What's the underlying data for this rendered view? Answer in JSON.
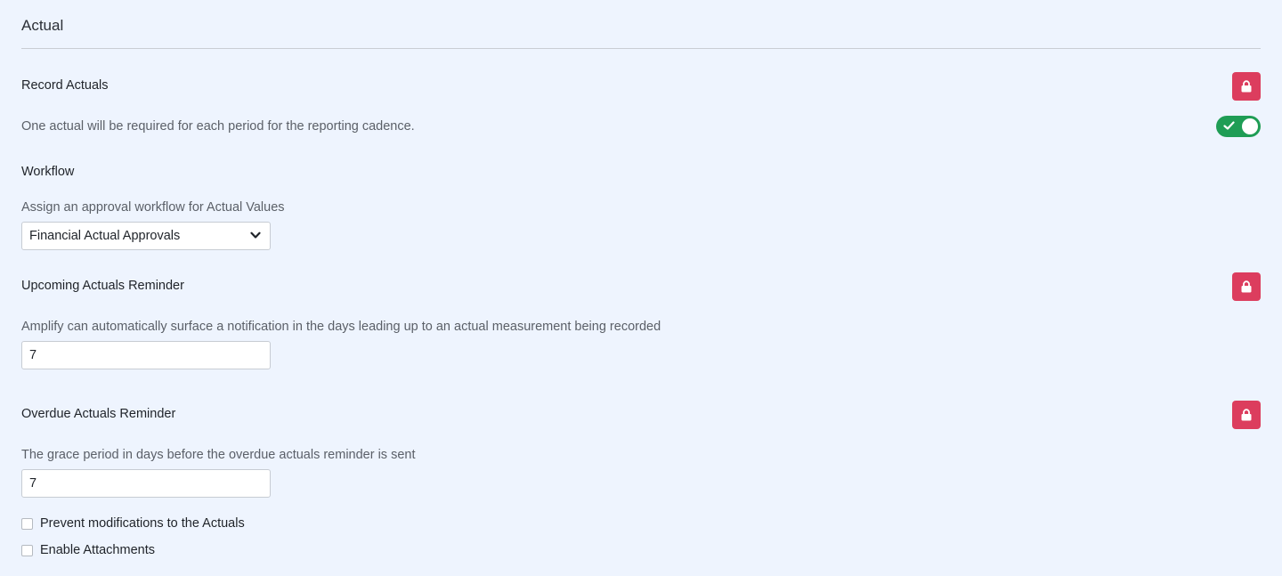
{
  "section": {
    "title": "Actual"
  },
  "record_actuals": {
    "heading": "Record Actuals",
    "description": "One actual will be required for each period for the reporting cadence.",
    "enabled": true
  },
  "workflow": {
    "heading": "Workflow",
    "description": "Assign an approval workflow for Actual Values",
    "selected": "Financial Actual Approvals"
  },
  "upcoming_reminder": {
    "heading": "Upcoming Actuals Reminder",
    "description": "Amplify can automatically surface a notification in the days leading up to an actual measurement being recorded",
    "value": "7"
  },
  "overdue_reminder": {
    "heading": "Overdue Actuals Reminder",
    "description": "The grace period in days before the overdue actuals reminder is sent",
    "value": "7"
  },
  "options": {
    "prevent_modifications": "Prevent modifications to the Actuals",
    "enable_attachments": "Enable Attachments"
  },
  "icons": {
    "lock": "lock-icon",
    "check": "check-icon",
    "chevron": "chevron-down-icon"
  },
  "colors": {
    "lock_button": "#dc3d5e",
    "toggle_on": "#1f9d55",
    "background": "#eef4fe"
  }
}
